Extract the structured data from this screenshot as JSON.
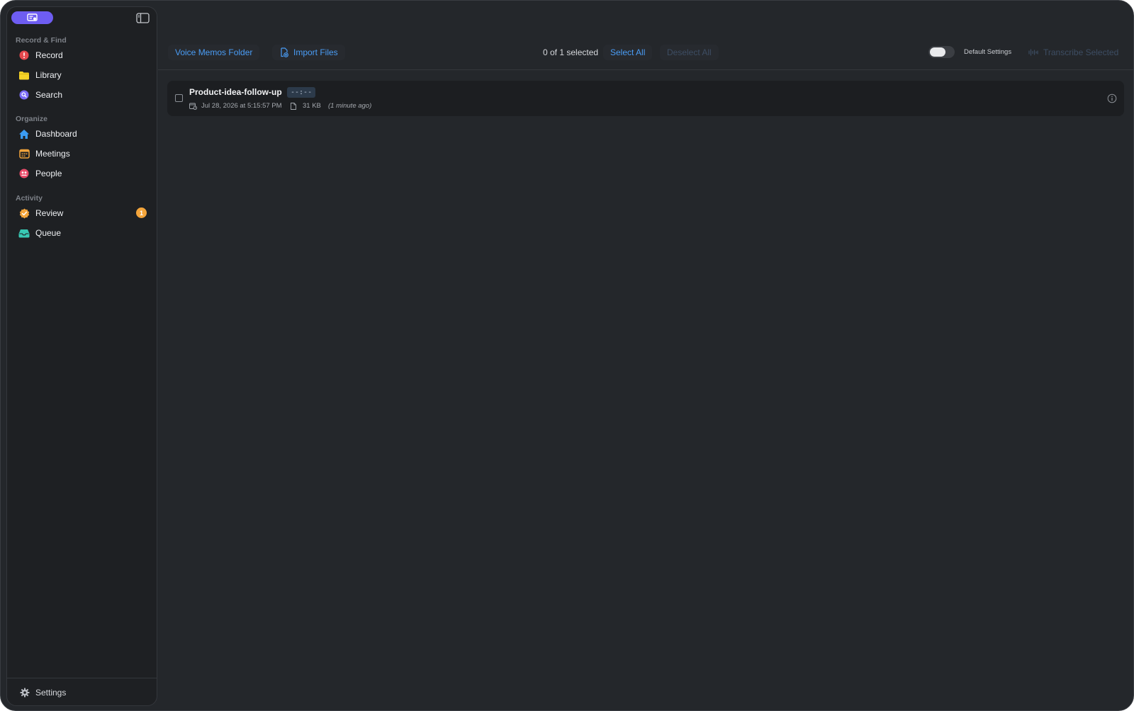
{
  "sidebar": {
    "sections": [
      {
        "label": "Record & Find",
        "items": [
          {
            "label": "Record",
            "icon": "record-icon",
            "color": "#e5484d"
          },
          {
            "label": "Library",
            "icon": "folder-icon",
            "color": "#f5d328"
          },
          {
            "label": "Search",
            "icon": "search-icon",
            "color": "#7b6cf6"
          }
        ]
      },
      {
        "label": "Organize",
        "items": [
          {
            "label": "Dashboard",
            "icon": "house-icon",
            "color": "#3b9cf3"
          },
          {
            "label": "Meetings",
            "icon": "calendar-icon",
            "color": "#f0a23b"
          },
          {
            "label": "People",
            "icon": "people-icon",
            "color": "#ea4c6a"
          }
        ]
      },
      {
        "label": "Activity",
        "items": [
          {
            "label": "Review",
            "icon": "checkmark-seal-icon",
            "color": "#f4a53b",
            "badge": "1"
          },
          {
            "label": "Queue",
            "icon": "tray-icon",
            "color": "#38c9b4"
          }
        ]
      }
    ],
    "settings_label": "Settings"
  },
  "toolbar": {
    "voice_memos_label": "Voice Memos Folder",
    "import_label": "Import Files",
    "selection_text": "0 of 1 selected",
    "select_all_label": "Select All",
    "deselect_all_label": "Deselect All",
    "default_settings_label": "Default Settings",
    "transcribe_label": "Transcribe Selected"
  },
  "files": [
    {
      "name": "Product-idea-follow-up",
      "duration": "--:--",
      "date": "Jul 28, 2026 at 5:15:57 PM",
      "size": "31 KB",
      "relative_time": "(1 minute ago)",
      "selected": false
    }
  ],
  "colors": {
    "accent": "#4a9df6",
    "app_pill": "#6e5df2",
    "badge": "#f4a53b"
  }
}
